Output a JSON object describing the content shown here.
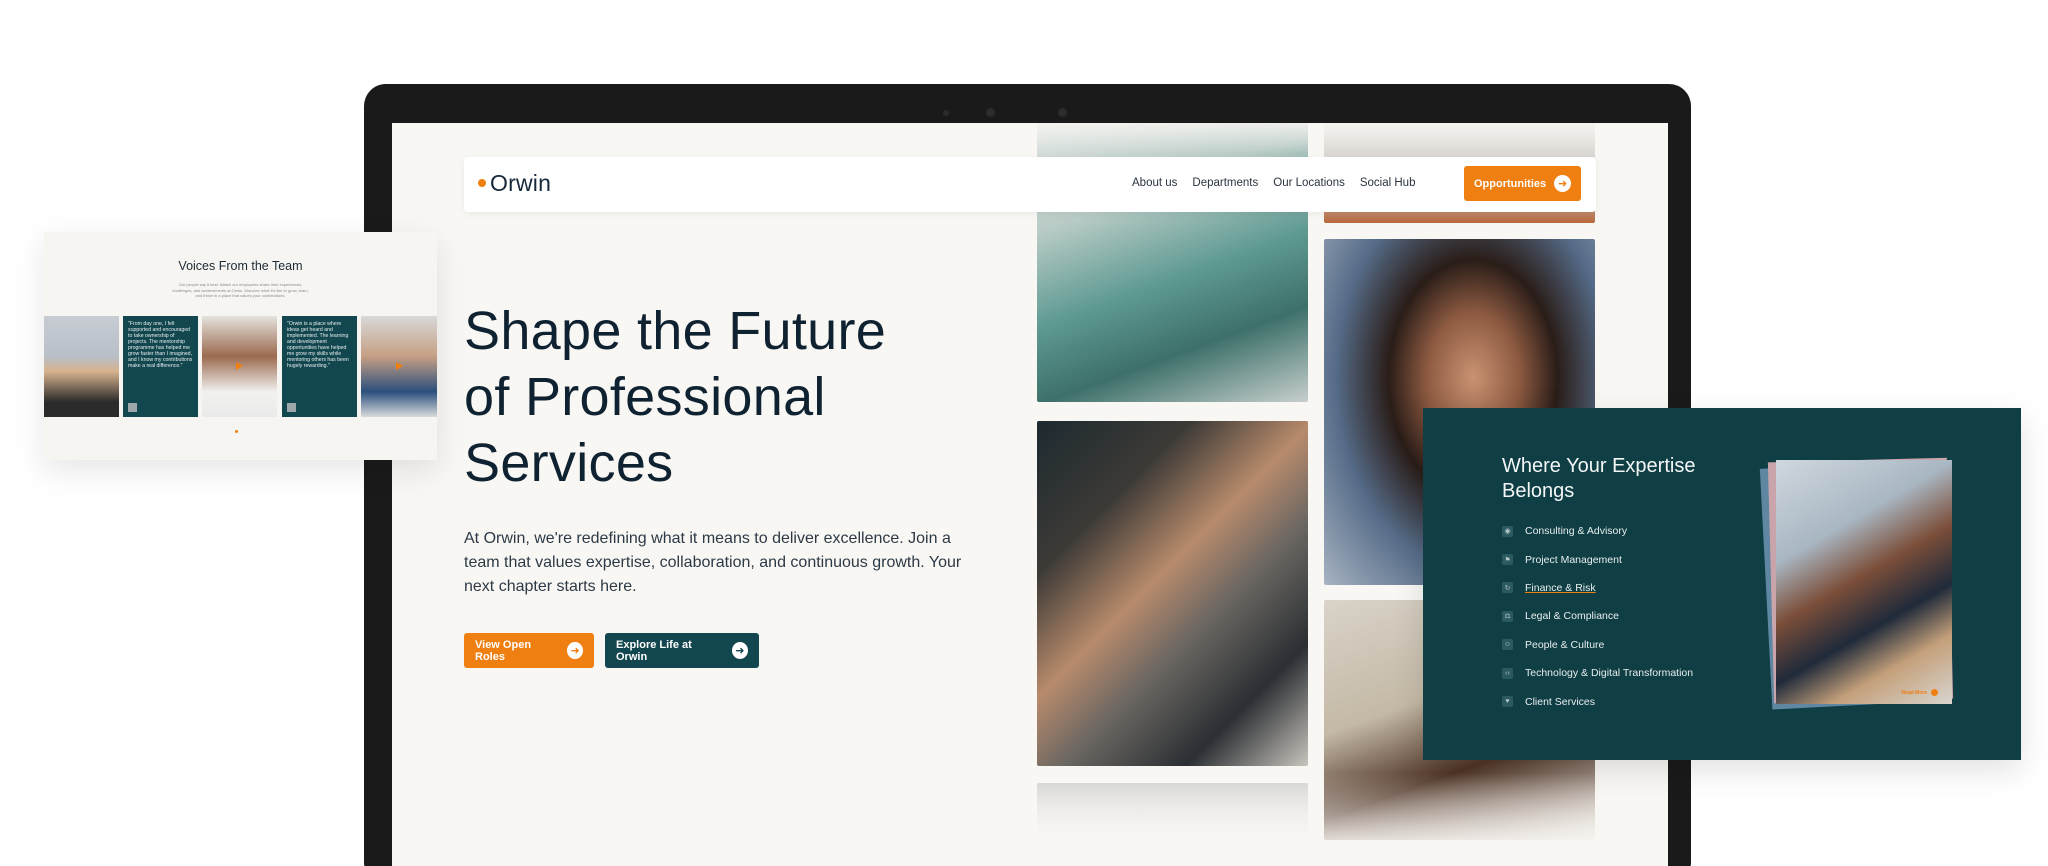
{
  "site": {
    "logo": "Orwin",
    "nav": [
      "About us",
      "Departments",
      "Our Locations",
      "Social Hub"
    ],
    "cta": "Opportunities"
  },
  "hero": {
    "title": "Shape the Future of Professional Services",
    "subtitle": "At Orwin, we're redefining what it means to deliver excellence. Join a team that values expertise, collaboration, and continuous growth. Your next chapter starts here.",
    "primary_button": "View Open Roles",
    "secondary_button": "Explore Life at Orwin"
  },
  "voices": {
    "title": "Voices From the Team",
    "subtitle": "Our people say it best. Watch our employees share their experiences, challenges, and achievements at Orwin. Discover what it's like to grow, learn, and thrive in a place that values your contributions.",
    "quotes": [
      {
        "text": "\"From day one, I felt supported and encouraged to take ownership of projects. The mentorship programme has helped me grow faster than I imagined, and I know my contributions make a real difference.\""
      },
      {
        "text": "\"Orwin is a place where ideas get heard and implemented. The learning and development opportunities have helped me grow my skills while mentoring others has been hugely rewarding.\""
      }
    ]
  },
  "expertise": {
    "title": "Where Your Expertise Belongs",
    "items": [
      {
        "label": "Consulting & Advisory",
        "icon": "person-icon"
      },
      {
        "label": "Project Management",
        "icon": "flag-icon"
      },
      {
        "label": "Finance & Risk",
        "icon": "refresh-icon"
      },
      {
        "label": "Legal & Compliance",
        "icon": "gavel-icon"
      },
      {
        "label": "People & Culture",
        "icon": "group-icon"
      },
      {
        "label": "Technology & Digital Transformation",
        "icon": "code-icon"
      },
      {
        "label": "Client Services",
        "icon": "heart-icon"
      }
    ],
    "active_index": 2,
    "read_more": "Read More"
  },
  "colors": {
    "accent": "#f07f12",
    "teal": "#12474f",
    "dark_teal_panel": "#0f3e45",
    "page_bg": "#f9f7f3"
  }
}
